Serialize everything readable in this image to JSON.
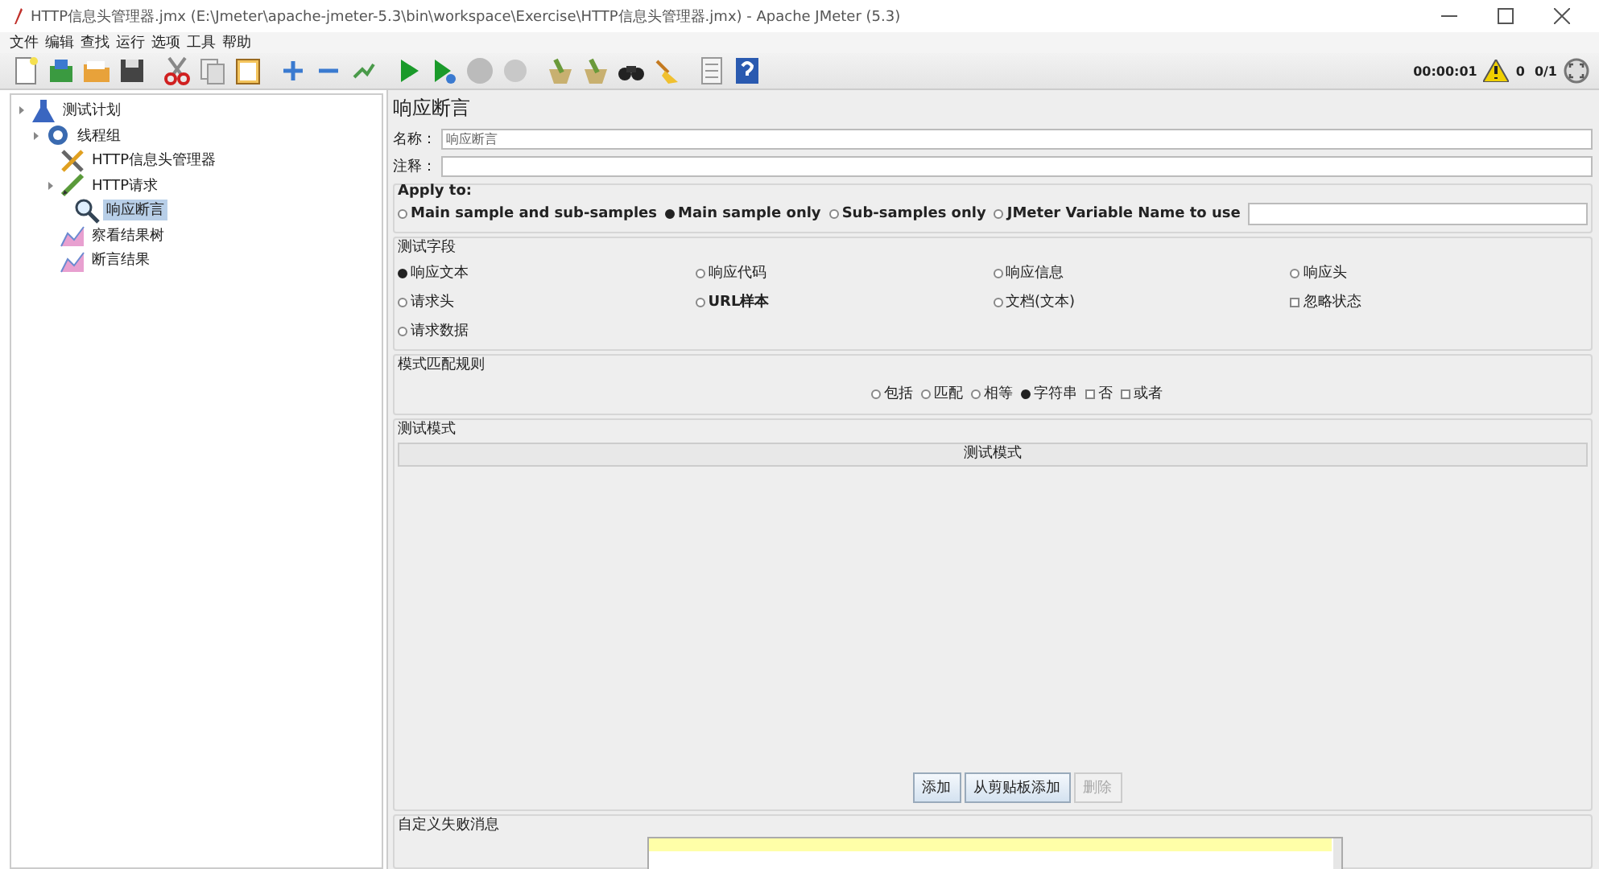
{
  "window": {
    "title": "HTTP信息头管理器.jmx (E:\\Jmeter\\apache-jmeter-5.3\\bin\\workspace\\Exercise\\HTTP信息头管理器.jmx) - Apache JMeter (5.3)"
  },
  "menu": [
    "文件",
    "编辑",
    "查找",
    "运行",
    "选项",
    "工具",
    "帮助"
  ],
  "status": {
    "elapsed": "00:00:01",
    "warnings": "0",
    "threads": "0/1"
  },
  "tree": [
    {
      "label": "测试计划",
      "kind": "plan",
      "selected": false,
      "children": [
        {
          "label": "线程组",
          "kind": "thread-group",
          "selected": false,
          "children": [
            {
              "label": "HTTP信息头管理器",
              "kind": "config",
              "selected": false
            },
            {
              "label": "HTTP请求",
              "kind": "sampler",
              "selected": false,
              "children": [
                {
                  "label": "响应断言",
                  "kind": "assertion",
                  "selected": true
                }
              ]
            },
            {
              "label": "察看结果树",
              "kind": "listener",
              "selected": false
            },
            {
              "label": "断言结果",
              "kind": "listener",
              "selected": false
            }
          ]
        }
      ]
    }
  ],
  "panel": {
    "title": "响应断言",
    "name": {
      "label": "名称：",
      "value": "响应断言"
    },
    "comment": {
      "label": "注释："
    },
    "apply_to": {
      "title": "Apply to:",
      "options": [
        {
          "label": "Main sample and sub-samples",
          "selected": false
        },
        {
          "label": "Main sample only",
          "selected": true
        },
        {
          "label": "Sub-samples only",
          "selected": false
        },
        {
          "label": "JMeter Variable Name to use",
          "selected": false
        }
      ]
    },
    "test_field": {
      "title": "测试字段",
      "options": [
        {
          "label": "响应文本",
          "kind": "radio",
          "selected": true
        },
        {
          "label": "响应代码",
          "kind": "radio",
          "selected": false
        },
        {
          "label": "响应信息",
          "kind": "radio",
          "selected": false
        },
        {
          "label": "响应头",
          "kind": "radio",
          "selected": false
        },
        {
          "label": "请求头",
          "kind": "radio",
          "selected": false
        },
        {
          "label": "URL样本",
          "kind": "radio",
          "selected": false
        },
        {
          "label": "文档(文本)",
          "kind": "radio",
          "selected": false
        },
        {
          "label": "忽略状态",
          "kind": "checkbox",
          "checked": false
        },
        {
          "label": "请求数据",
          "kind": "radio",
          "selected": false
        }
      ]
    },
    "pattern_rules": {
      "title": "模式匹配规则",
      "options": [
        {
          "label": "包括",
          "kind": "radio",
          "selected": false
        },
        {
          "label": "匹配",
          "kind": "radio",
          "selected": false
        },
        {
          "label": "相等",
          "kind": "radio",
          "selected": false
        },
        {
          "label": "字符串",
          "kind": "radio",
          "selected": true
        },
        {
          "label": "否",
          "kind": "checkbox",
          "checked": false
        },
        {
          "label": "或者",
          "kind": "checkbox",
          "checked": false
        }
      ]
    },
    "patterns": {
      "title": "测试模式",
      "column": "测试模式"
    },
    "buttons": [
      {
        "label": "添加",
        "disabled": false
      },
      {
        "label": "从剪贴板添加",
        "disabled": false
      },
      {
        "label": "删除",
        "disabled": true
      }
    ],
    "failure_message": {
      "title": "自定义失败消息"
    }
  }
}
